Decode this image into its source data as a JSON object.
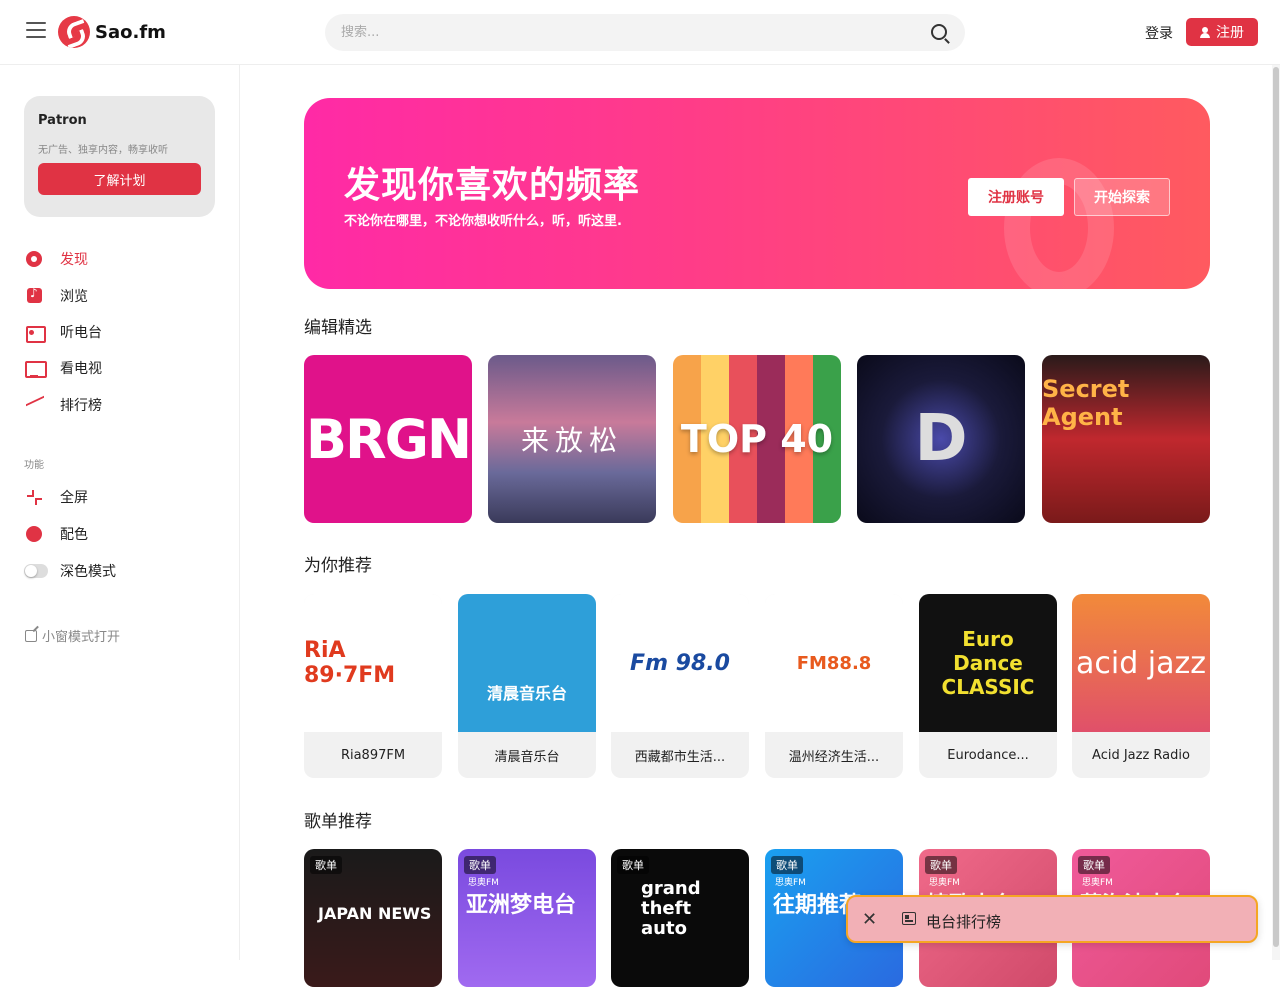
{
  "header": {
    "brand": "Sao.fm",
    "search_placeholder": "搜索...",
    "login": "登录",
    "register": "注册"
  },
  "patron": {
    "title": "Patron",
    "subtitle": "无广告、独享内容，畅享收听",
    "button": "了解计划"
  },
  "nav": {
    "discover": "发现",
    "browse": "浏览",
    "radio": "听电台",
    "tv": "看电视",
    "charts": "排行榜",
    "section": "功能",
    "fullscreen": "全屏",
    "color": "配色",
    "dark_mode": "深色模式",
    "mini_window": "小窗模式打开"
  },
  "hero": {
    "title": "发现你喜欢的频率",
    "subtitle": "不论你在哪里，不论你想收听什么，听，听这里.",
    "btn_register": "注册账号",
    "btn_explore": "开始探索"
  },
  "sections": {
    "editor": "编辑精选",
    "recommend": "为你推荐",
    "playlists": "歌单推荐"
  },
  "editor_picks": [
    {
      "art_text": "BRGN",
      "color": "#e0128a"
    },
    {
      "art_text": "来放松",
      "color": "#7a5a8a"
    },
    {
      "art_text": "TOP 40",
      "color": "#f5b942"
    },
    {
      "art_text": "D",
      "color": "#1a1a2e"
    },
    {
      "art_text": "Secret Agent",
      "color": "#c0282e"
    }
  ],
  "recommended": [
    {
      "name": "Ria897FM",
      "art_text": "RiA 89·7FM"
    },
    {
      "name": "清晨音乐台",
      "art_text": "清晨音乐台"
    },
    {
      "name": "西藏都市生活...",
      "art_text": "Fm 98.0"
    },
    {
      "name": "温州经济生活...",
      "art_text": "FM88.8"
    },
    {
      "name": "Eurodance...",
      "art_text": "Euro Dance CLASSIC"
    },
    {
      "name": "Acid Jazz Radio",
      "art_text": "acid jazz"
    }
  ],
  "playlists": [
    {
      "badge": "歌单",
      "brand": "",
      "title": "JAPAN NEWS"
    },
    {
      "badge": "歌单",
      "brand": "思奥FM",
      "title": "亚洲梦电台"
    },
    {
      "badge": "歌单",
      "brand": "",
      "title": "grand theft auto"
    },
    {
      "badge": "歌单",
      "brand": "思奥FM",
      "title": "往期推荐"
    },
    {
      "badge": "歌单",
      "brand": "思奥FM",
      "title": "情歌电台"
    },
    {
      "badge": "歌单",
      "brand": "思奥FM",
      "title": "蓝海波电台"
    }
  ],
  "toast": {
    "text": "电台排行榜"
  },
  "colors": {
    "accent": "#e03344",
    "hero_start": "#ff2aa6",
    "hero_end": "#ff5a5f"
  }
}
